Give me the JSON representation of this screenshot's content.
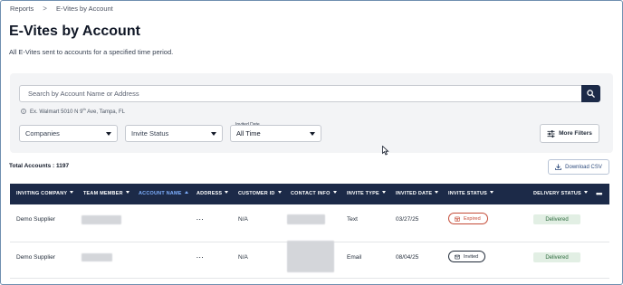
{
  "breadcrumb": {
    "items": [
      "Reports",
      "E-Vites by Account"
    ],
    "separator": ">"
  },
  "page": {
    "title": "E-Vites by Account",
    "subtitle": "All E-Vites sent to accounts for a specified time period."
  },
  "search": {
    "placeholder": "Search by Account Name or Address",
    "value": "",
    "hint_prefix": "Ex. Walmart 5010 N 9",
    "hint_sup": "th",
    "hint_suffix": " Ave, Tampa, FL"
  },
  "filters": {
    "companies": {
      "value": "Companies"
    },
    "invite_status": {
      "value": "Invite Status"
    },
    "invited_date": {
      "label": "Invited Date",
      "value": "All Time"
    },
    "more_filters_label": "More Filters"
  },
  "summary": {
    "total_label": "Total Accounts : 1197"
  },
  "download_label": "Download CSV",
  "table": {
    "columns": [
      {
        "label": "INVITING COMPANY",
        "sort": "down"
      },
      {
        "label": "TEAM MEMBER",
        "sort": "down"
      },
      {
        "label": "ACCOUNT NAME",
        "sort": "up",
        "active": true
      },
      {
        "label": "ADDRESS",
        "sort": "down"
      },
      {
        "label": "CUSTOMER ID",
        "sort": "down"
      },
      {
        "label": "CONTACT INFO",
        "sort": "down"
      },
      {
        "label": "INVITE TYPE",
        "sort": "down"
      },
      {
        "label": "INVITED DATE",
        "sort": "down"
      },
      {
        "label": "INVITE STATUS",
        "sort": "down"
      },
      {
        "label": "DELIVERY STATUS",
        "sort": "down"
      }
    ],
    "more_menu": "•••",
    "rows": [
      {
        "company": "Demo Supplier",
        "address": "...",
        "customer_id": "N/A",
        "invite_type": "Text",
        "invited_date": "03/27/25",
        "invite_status": "Expired",
        "delivery_status": "Delivered"
      },
      {
        "company": "Demo Supplier",
        "address": "...",
        "customer_id": "N/A",
        "invite_type": "Email",
        "invited_date": "08/04/25",
        "invite_status": "Invited",
        "delivery_status": "Delivered"
      }
    ]
  },
  "colors": {
    "header_bg": "#1c2a48",
    "active_column": "#7fb0ff",
    "expired": "#c44a36",
    "delivered_bg": "#e2efe4",
    "delivered_text": "#2e6b3e",
    "download_text": "#2c4a7c"
  },
  "icons": {
    "search": "search-icon",
    "hint": "info-circle-icon",
    "more_filters": "sliders-icon",
    "download": "download-icon",
    "expired": "calendar-x-icon",
    "invited": "envelope-icon"
  }
}
